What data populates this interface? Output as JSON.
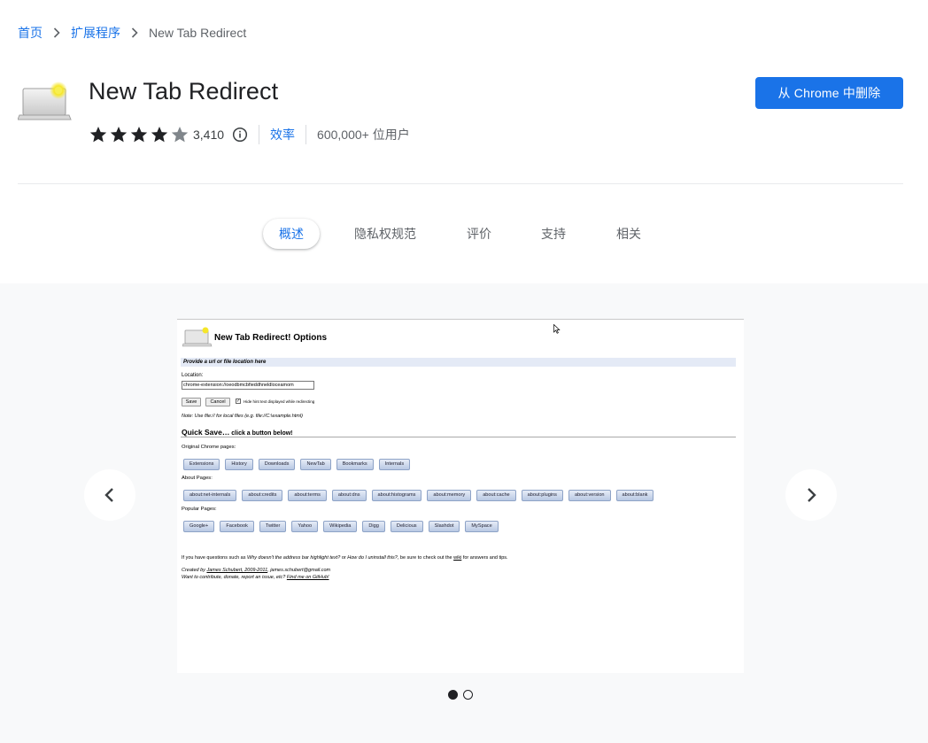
{
  "breadcrumb": {
    "home": "首页",
    "extensions": "扩展程序",
    "current": "New Tab Redirect"
  },
  "extension": {
    "title": "New Tab Redirect",
    "rating_value": 4,
    "rating_count": "3,410",
    "category": "效率",
    "users": "600,000+ 位用户",
    "remove_label": "从 Chrome 中删除"
  },
  "colors": {
    "accent": "#1a73e8",
    "star": "#202124",
    "star_empty": "#80868b"
  },
  "tabs": [
    {
      "label": "概述",
      "active": true
    },
    {
      "label": "隐私权规范",
      "active": false
    },
    {
      "label": "评价",
      "active": false
    },
    {
      "label": "支持",
      "active": false
    },
    {
      "label": "相关",
      "active": false
    }
  ],
  "gallery": {
    "prev_icon": "chevron-left-icon",
    "next_icon": "chevron-right-icon",
    "slide_count": 2,
    "active_slide": 1,
    "screenshot": {
      "title": "New Tab Redirect! Options",
      "band_text": "Provide a url or file location here",
      "location_label": "Location:",
      "location_value": "chrome-extension://oeodbmcbfieddhneldloceamom",
      "save_label": "Save",
      "cancel_label": "Cancel",
      "checkbox_label": "Hide hint text displayed while redirecting",
      "note": "Note: Use file:// for local files (e.g. file://C:\\example.html)",
      "quick_save": "Quick Save…",
      "quick_save_sub": " click a button below!",
      "original_label": "Original Chrome pages:",
      "original_buttons": [
        "Extensions",
        "History",
        "Downloads",
        "NewTab",
        "Bookmarks",
        "Internals"
      ],
      "about_label": "About Pages:",
      "about_buttons": [
        "about:net-internals",
        "about:credits",
        "about:terms",
        "about:dns",
        "about:histograms",
        "about:memory",
        "about:cache",
        "about:plugins",
        "about:version",
        "about:blank"
      ],
      "popular_label": "Popular Pages:",
      "popular_buttons": [
        "Google+",
        "Facebook",
        "Twitter",
        "Yahoo",
        "Wikipedia",
        "Digg",
        "Delicious",
        "Slashdot",
        "MySpace"
      ],
      "footer_q_a": "If you have questions such as ",
      "footer_q_b": "Why doesn't the address bar highlight text?",
      "footer_q_c": " or ",
      "footer_q_d": "How do I uninstall this?",
      "footer_q_e": ", be sure to check out the ",
      "footer_q_f": "wiki",
      "footer_q_g": " for answers and tips.",
      "created_a": "Created by ",
      "created_b": "James Schubert, 2009-2011",
      "created_c": ", james.schubert@gmail.com",
      "contribute_a": "Want to contribute, donate, report an issue, etc? ",
      "contribute_b": "Find me on GitHub!"
    }
  }
}
